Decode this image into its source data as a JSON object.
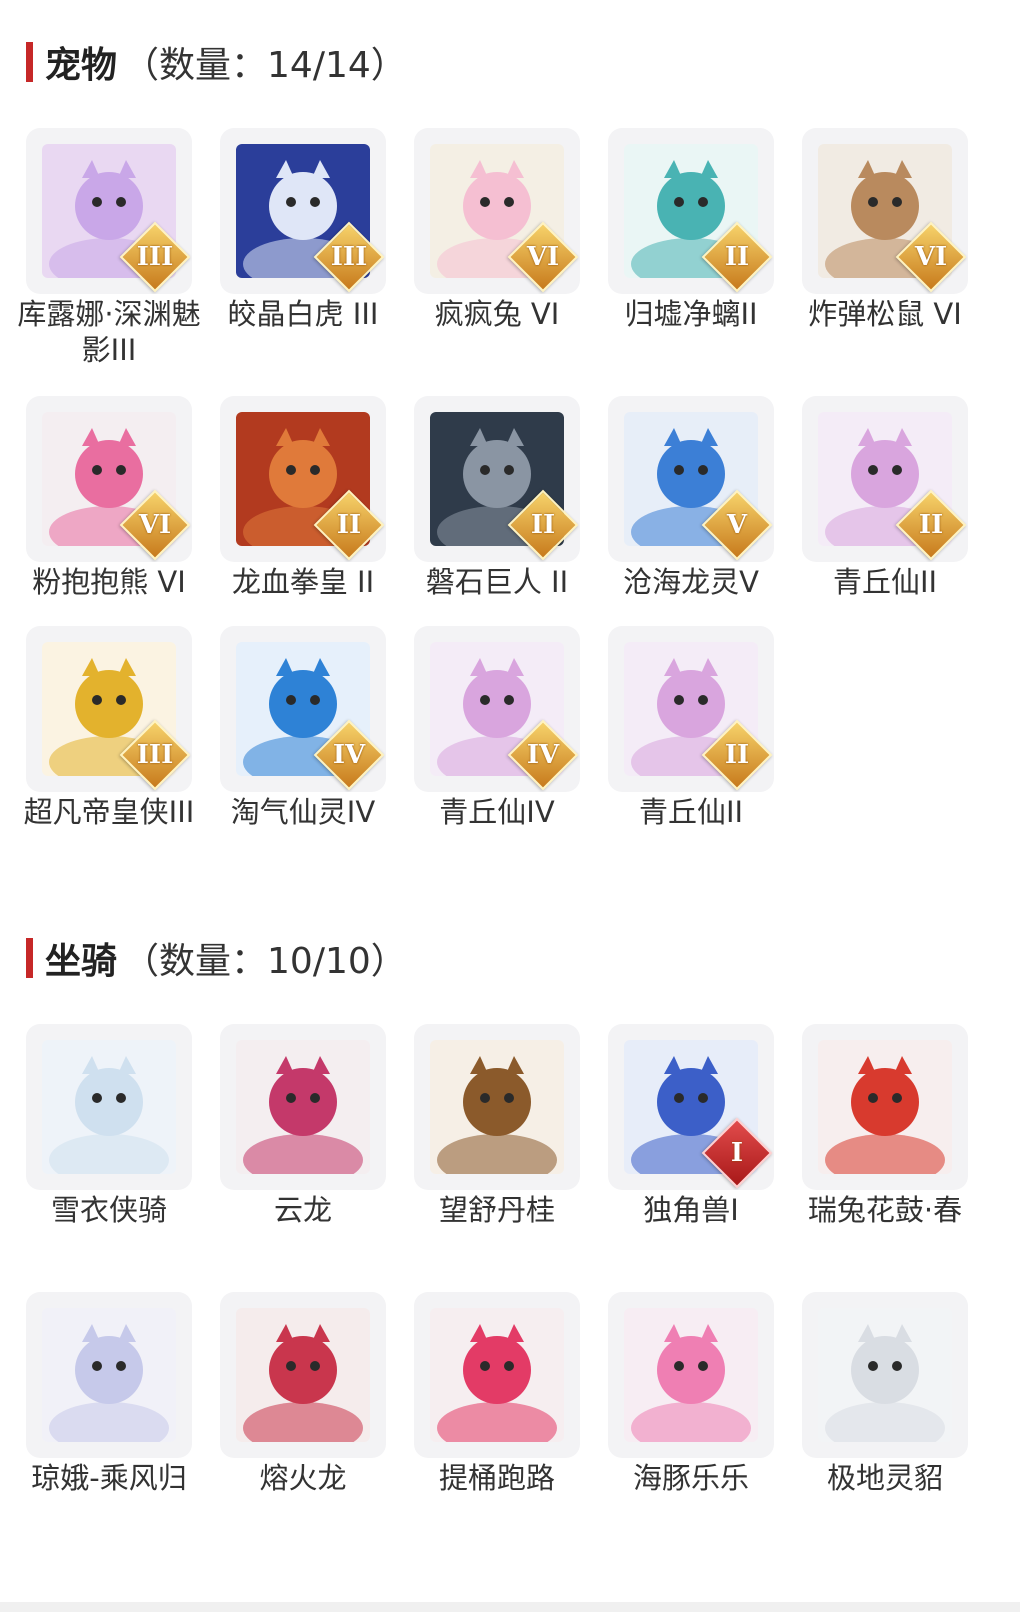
{
  "pets": {
    "title": "宠物",
    "count_label": "（数量：14/14）",
    "items": [
      {
        "name": "库露娜·深渊魅影III",
        "rank": "III",
        "icon": "ghost-girl-icon",
        "bg": "#e9d8f2",
        "fg": "#c9a7e8"
      },
      {
        "name": "皎晶白虎 III",
        "rank": "III",
        "icon": "white-tiger-icon",
        "bg": "#2b3e9a",
        "fg": "#dfe6f7"
      },
      {
        "name": "疯疯兔 VI",
        "rank": "VI",
        "icon": "rabbit-icon",
        "bg": "#f4efe4",
        "fg": "#f5bfd2"
      },
      {
        "name": "归墟净螭II",
        "rank": "II",
        "icon": "jade-dragon-icon",
        "bg": "#eaf6f5",
        "fg": "#49b3b3"
      },
      {
        "name": "炸弹松鼠 VI",
        "rank": "VI",
        "icon": "squirrel-icon",
        "bg": "#f1ebe3",
        "fg": "#b98a5e"
      },
      {
        "name": "粉抱抱熊 VI",
        "rank": "VI",
        "icon": "pink-bear-icon",
        "bg": "#f4eef1",
        "fg": "#e96ea0"
      },
      {
        "name": "龙血拳皇 II",
        "rank": "II",
        "icon": "ram-warrior-icon",
        "bg": "#b23a1f",
        "fg": "#e07a3a"
      },
      {
        "name": "磐石巨人 II",
        "rank": "II",
        "icon": "stone-giant-icon",
        "bg": "#2f3b4a",
        "fg": "#8a95a3"
      },
      {
        "name": "沧海龙灵V",
        "rank": "V",
        "icon": "sea-dragon-boy-icon",
        "bg": "#e7eef8",
        "fg": "#3c7fd6"
      },
      {
        "name": "青丘仙II",
        "rank": "II",
        "icon": "fox-fairy-icon",
        "bg": "#f4ecf7",
        "fg": "#d9a5de"
      },
      {
        "name": "超凡帝皇侠III",
        "rank": "III",
        "icon": "golden-armor-icon",
        "bg": "#fbf3e2",
        "fg": "#e3b22d"
      },
      {
        "name": "淘气仙灵IV",
        "rank": "IV",
        "icon": "blue-dog-icon",
        "bg": "#e6f0fb",
        "fg": "#2e82d6"
      },
      {
        "name": "青丘仙IV",
        "rank": "IV",
        "icon": "fox-fairy-icon",
        "bg": "#f4ecf7",
        "fg": "#d9a5de"
      },
      {
        "name": "青丘仙II",
        "rank": "II",
        "icon": "fox-fairy-icon",
        "bg": "#f4ecf7",
        "fg": "#d9a5de"
      }
    ]
  },
  "mounts": {
    "title": "坐骑",
    "count_label": "（数量：10/10）",
    "items": [
      {
        "name": "雪衣侠骑",
        "rank": "",
        "icon": "white-horse-icon",
        "bg": "#eef3f9",
        "fg": "#cfe0ef"
      },
      {
        "name": "云龙",
        "rank": "",
        "icon": "cloud-dragon-icon",
        "bg": "#f4eef0",
        "fg": "#c4396a"
      },
      {
        "name": "望舒丹桂",
        "rank": "",
        "icon": "swing-icon",
        "bg": "#f6efe6",
        "fg": "#8b5a2b"
      },
      {
        "name": "独角兽I",
        "rank": "I",
        "icon": "unicorn-icon",
        "bg": "#e7edf9",
        "fg": "#3c5fc8"
      },
      {
        "name": "瑞兔花鼓·春",
        "rank": "",
        "icon": "drum-rabbit-icon",
        "bg": "#f7eeee",
        "fg": "#d83a2e"
      },
      {
        "name": "琼娥-乘风归",
        "rank": "",
        "icon": "moon-lady-icon",
        "bg": "#f1f1f8",
        "fg": "#c6c9ea"
      },
      {
        "name": "熔火龙",
        "rank": "",
        "icon": "lava-dragon-icon",
        "bg": "#f5ecec",
        "fg": "#c9364d"
      },
      {
        "name": "提桶跑路",
        "rank": "",
        "icon": "bucket-icon",
        "bg": "#f6eef0",
        "fg": "#e33b66"
      },
      {
        "name": "海豚乐乐",
        "rank": "",
        "icon": "dolphin-icon",
        "bg": "#f7edf3",
        "fg": "#ef7fb3"
      },
      {
        "name": "极地灵貂",
        "rank": "",
        "icon": "arctic-fox-icon",
        "bg": "#f2f4f6",
        "fg": "#d9dde3"
      }
    ]
  }
}
